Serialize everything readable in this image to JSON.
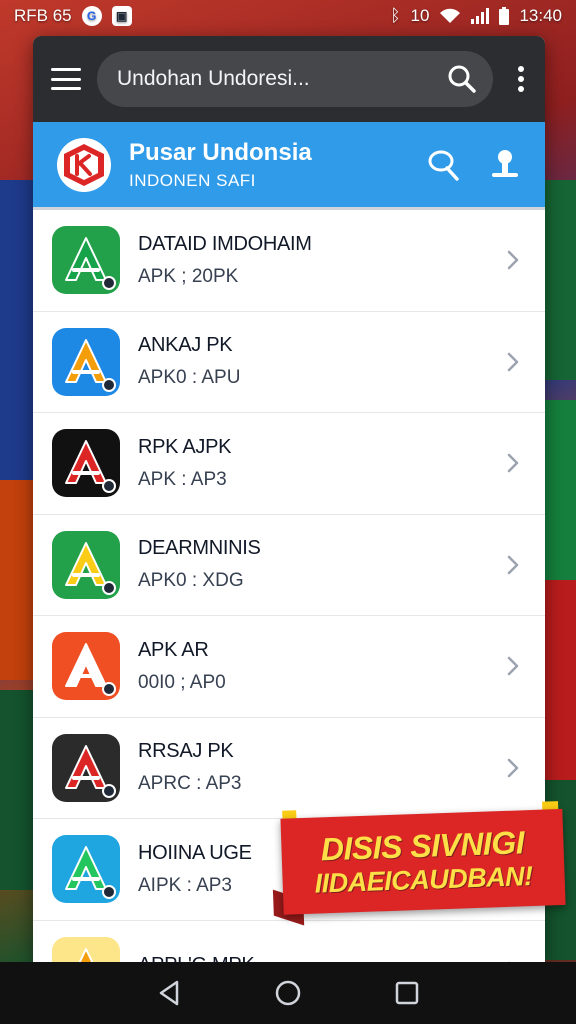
{
  "status_bar": {
    "left_text": "RFB 65",
    "time": "13:40",
    "battery_text": "10"
  },
  "toolbar": {
    "search_value": "Undohan Undoresi..."
  },
  "header": {
    "title": "Pusar Undonsia",
    "subtitle": "INDONEN SAFI"
  },
  "apps": [
    {
      "title": "DATAID IMDOHAIM",
      "subtitle": "APK ; 20PK",
      "icon_color": "#16a34a",
      "icon_bg": "#22a04a",
      "icon_name": "apk-app-icon"
    },
    {
      "title": "ANKAJ PK",
      "subtitle": "APK0 : APU",
      "icon_color": "#f59e0b",
      "icon_bg": "#1e88e5",
      "icon_name": "apk-app-icon"
    },
    {
      "title": "RPK AJPK",
      "subtitle": "APK : AP3",
      "icon_color": "#dc2626",
      "icon_bg": "#111111",
      "icon_name": "apk-app-icon"
    },
    {
      "title": "DEARMNINIS",
      "subtitle": "APK0 : XDG",
      "icon_color": "#facc15",
      "icon_bg": "#22a04a",
      "icon_name": "apk-app-icon"
    },
    {
      "title": "APK AR",
      "subtitle": "00I0 ; AP0",
      "icon_color": "#ffffff",
      "icon_bg": "#f04e23",
      "icon_name": "apk-app-icon"
    },
    {
      "title": "RRSAJ PK",
      "subtitle": "APRC : AP3",
      "icon_color": "#dc2626",
      "icon_bg": "#2b2b2b",
      "icon_name": "apk-app-icon"
    },
    {
      "title": "HOIINA UGE",
      "subtitle": "AIPK : AP3",
      "icon_color": "#22c55e",
      "icon_bg": "#1fa5e0",
      "icon_name": "apk-app-icon"
    },
    {
      "title": "APPL'G MPK",
      "subtitle": "",
      "icon_color": "#f59e0b",
      "icon_bg": "#fde68a",
      "icon_name": "apk-app-icon"
    }
  ],
  "promo": {
    "line1": "DISIS SIVNIGI",
    "line2": "IIDAEICAUDBAN!"
  },
  "colors": {
    "toolbar": "#2b2d30",
    "header": "#2f9be9",
    "promo": "#dc2626",
    "promo_text": "#fde047"
  }
}
